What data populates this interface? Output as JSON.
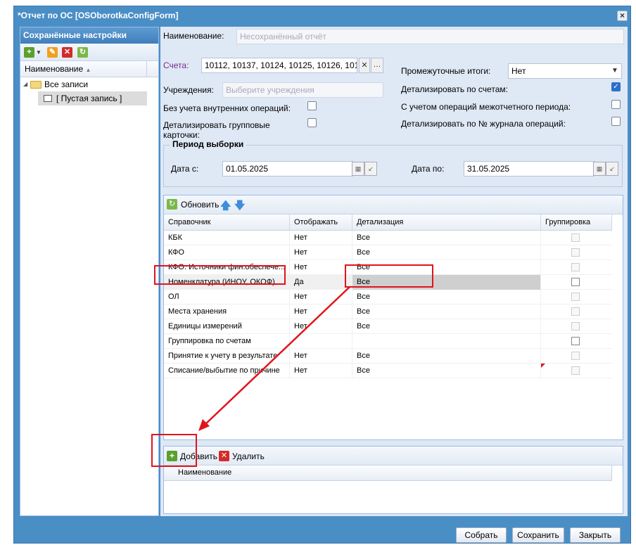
{
  "window": {
    "title": "*Отчет по ОС [OSOborotkaConfigForm]"
  },
  "left": {
    "header": "Сохранённые настройки",
    "column": "Наименование",
    "tree": {
      "root": "Все записи",
      "child": "[ Пустая запись ]"
    }
  },
  "form": {
    "name_label": "Наименование:",
    "name_placeholder": "Несохранённый отчёт",
    "accounts_label": "Счета:",
    "accounts_value": "10112, 10137, 10124, 10125, 10126, 101",
    "institutions_label": "Учреждения:",
    "institutions_placeholder": "Выберите учреждения",
    "no_internal_label": "Без учета внутренних операций:",
    "detail_group_label": "Детализировать групповые карточки:",
    "intermediate_label": "Промежуточные итоги:",
    "intermediate_value": "Нет",
    "detail_accounts_label": "Детализировать по счетам:",
    "interperiod_label": "С учетом операций межотчетного периода:",
    "detail_journal_label": "Детализировать по № журнала операций:",
    "period_legend": "Период выборки",
    "date_from_label": "Дата с:",
    "date_from": "01.05.2025",
    "date_to_label": "Дата по:",
    "date_to": "31.05.2025"
  },
  "grid": {
    "refresh_label": "Обновить",
    "columns": [
      "Справочник",
      "Отображать",
      "Детализация",
      "Группировка"
    ],
    "rows": [
      {
        "ref": "КБК",
        "show": "Нет",
        "detail": "Все"
      },
      {
        "ref": "КФО",
        "show": "Нет",
        "detail": "Все"
      },
      {
        "ref": "КФО: Источники фин.обеспече...",
        "show": "Нет",
        "detail": "Все"
      },
      {
        "ref": "Номенклатура (ИНОУ, ОКОФ)",
        "show": "Да",
        "detail": "Все"
      },
      {
        "ref": "ОЛ",
        "show": "Нет",
        "detail": "Все"
      },
      {
        "ref": "Места хранения",
        "show": "Нет",
        "detail": "Все"
      },
      {
        "ref": "Единицы измерений",
        "show": "Нет",
        "detail": "Все"
      },
      {
        "ref": "Группировка по счетам",
        "show": "",
        "detail": ""
      },
      {
        "ref": "Принятие к учету в результате",
        "show": "Нет",
        "detail": "Все"
      },
      {
        "ref": "Списание/выбытие по причине",
        "show": "Нет",
        "detail": "Все"
      }
    ]
  },
  "bottom": {
    "add_label": "Добавить",
    "delete_label": "Удалить",
    "column": "Наименование"
  },
  "footer": {
    "collect": "Собрать",
    "save": "Сохранить",
    "close": "Закрыть"
  }
}
